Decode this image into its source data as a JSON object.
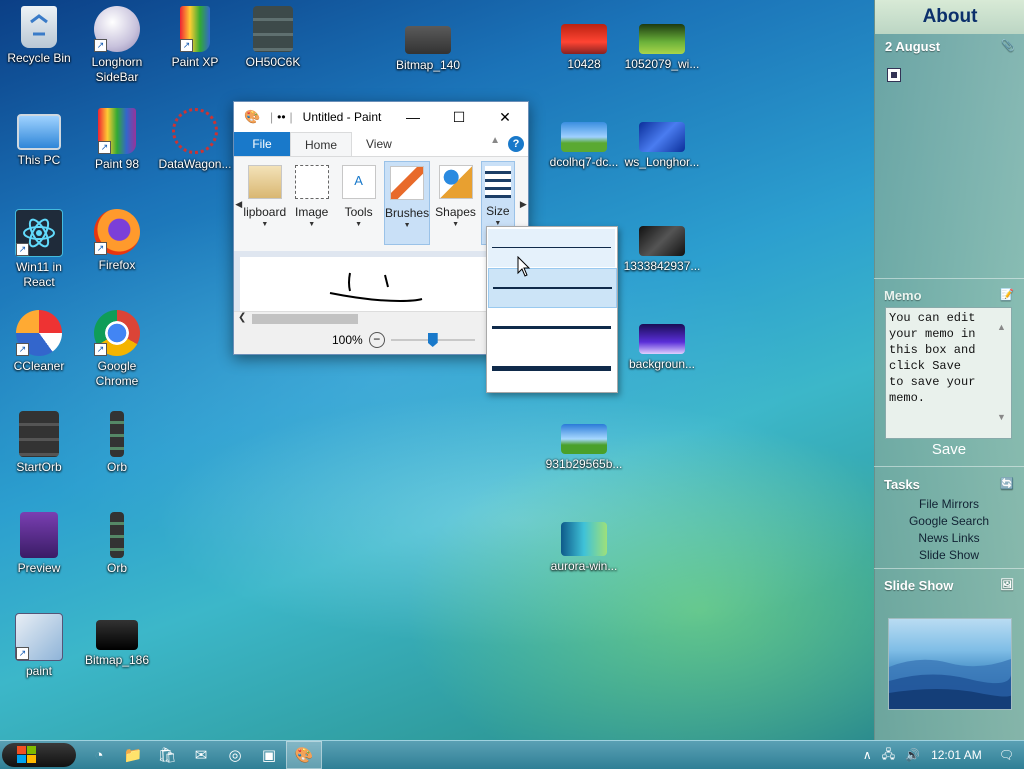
{
  "desktop": {
    "icons": [
      {
        "label": "Recycle Bin"
      },
      {
        "label": "Longhorn SideBar"
      },
      {
        "label": "Paint XP"
      },
      {
        "label": "OH50C6K"
      },
      {
        "label": "Bitmap_140"
      },
      {
        "label": "10428"
      },
      {
        "label": "1052079_wi..."
      },
      {
        "label": "This PC"
      },
      {
        "label": "Paint 98"
      },
      {
        "label": "DataWagon..."
      },
      {
        "label": "dcolhq7-dc..."
      },
      {
        "label": "ws_Longhor..."
      },
      {
        "label": "Win11 in React"
      },
      {
        "label": "Firefox"
      },
      {
        "label": "1333842937..."
      },
      {
        "label": "CCleaner"
      },
      {
        "label": "Google Chrome"
      },
      {
        "label": "backgroun..."
      },
      {
        "label": "StartOrb"
      },
      {
        "label": "Orb"
      },
      {
        "label": "931b29565b..."
      },
      {
        "label": "Preview"
      },
      {
        "label": "Orb"
      },
      {
        "label": "aurora-win..."
      },
      {
        "label": "paint"
      },
      {
        "label": "Bitmap_186"
      }
    ]
  },
  "paint": {
    "title": "Untitled - Paint",
    "quick_access": "••",
    "tabs": {
      "file": "File",
      "home": "Home",
      "view": "View"
    },
    "help": "?",
    "groups": {
      "clipboard": "lipboard",
      "image": "Image",
      "tools": "Tools",
      "brushes": "Brushes",
      "shapes": "Shapes",
      "size": "Size"
    },
    "zoom": "100%",
    "zoom_level_fraction": 0.5
  },
  "size_menu": {
    "options": [
      "1px",
      "3px",
      "5px",
      "8px"
    ],
    "selected_index": 1
  },
  "sidebar": {
    "title": "About",
    "clock": {
      "date": "2 August"
    },
    "memo": {
      "title": "Memo",
      "text": "You can edit\nyour memo in\nthis box and\nclick Save\nto save your\nmemo.",
      "save": "Save"
    },
    "tasks": {
      "title": "Tasks",
      "items": [
        "File Mirrors",
        "Google Search",
        "News Links",
        "Slide Show"
      ]
    },
    "slideshow": {
      "title": "Slide Show"
    }
  },
  "taskbar": {
    "clock": "12:01 AM"
  },
  "colors": {
    "accent": "#1979ca",
    "ribbon_bg": "#f5f6f7",
    "sidebar_title": "#0b2f6b"
  }
}
